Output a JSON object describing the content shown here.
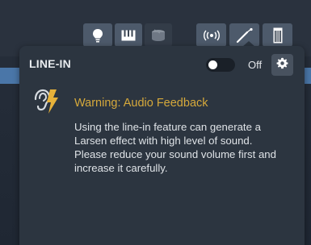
{
  "toolbar": {
    "buttons": [
      {
        "icon": "bulb-icon",
        "active": true
      },
      {
        "icon": "piano-keys-icon",
        "active": true
      },
      {
        "icon": "drum-icon",
        "active": false
      },
      {
        "icon": "wireless-icon",
        "active": true
      },
      {
        "icon": "guitar-cable-icon",
        "active": true
      },
      {
        "icon": "amp-icon",
        "active": true
      }
    ]
  },
  "panel": {
    "title": "LINE-IN",
    "toggle_state": "Off",
    "toggle_on": false
  },
  "warning": {
    "icon": "ear-lightning-icon",
    "title": "Warning: Audio Feedback",
    "body_line1": "Using the line-in feature can generate a Larsen effect with high level of sound.",
    "body_line2": "Please reduce your sound volume first and increase it carefully."
  },
  "colors": {
    "accent": "#d6a93b",
    "panel_bg": "#2c3540",
    "strip_blue": "#4a76a8"
  }
}
